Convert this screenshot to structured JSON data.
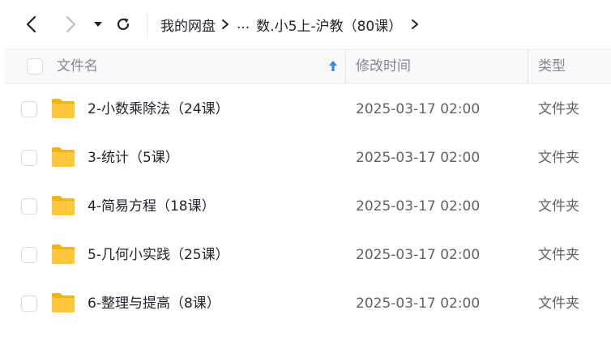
{
  "toolbar": {
    "back_icon": "chevron-left-icon",
    "forward_icon": "chevron-right-icon",
    "history_icon": "caret-down-icon",
    "refresh_icon": "refresh-icon"
  },
  "breadcrumb": {
    "root": "我的网盘",
    "ellipsis": "...",
    "current": "数.小5上-沪教（80课）"
  },
  "table": {
    "columns": {
      "name": "文件名",
      "modified": "修改时间",
      "type": "类型"
    },
    "sort": {
      "column": "name",
      "direction": "ascending",
      "color": "#2f8cf0"
    },
    "rows": [
      {
        "name": "2-小数乘除法（24课）",
        "modified": "2025-03-17 02:00",
        "type": "文件夹"
      },
      {
        "name": "3-统计（5课）",
        "modified": "2025-03-17 02:00",
        "type": "文件夹"
      },
      {
        "name": "4-简易方程（18课）",
        "modified": "2025-03-17 02:00",
        "type": "文件夹"
      },
      {
        "name": "5-几何小实践（25课）",
        "modified": "2025-03-17 02:00",
        "type": "文件夹"
      },
      {
        "name": "6-整理与提高（8课）",
        "modified": "2025-03-17 02:00",
        "type": "文件夹"
      }
    ]
  },
  "colors": {
    "folder": "#ffc73a",
    "header_bg": "#f7f8fa",
    "accent": "#2f8cf0"
  }
}
